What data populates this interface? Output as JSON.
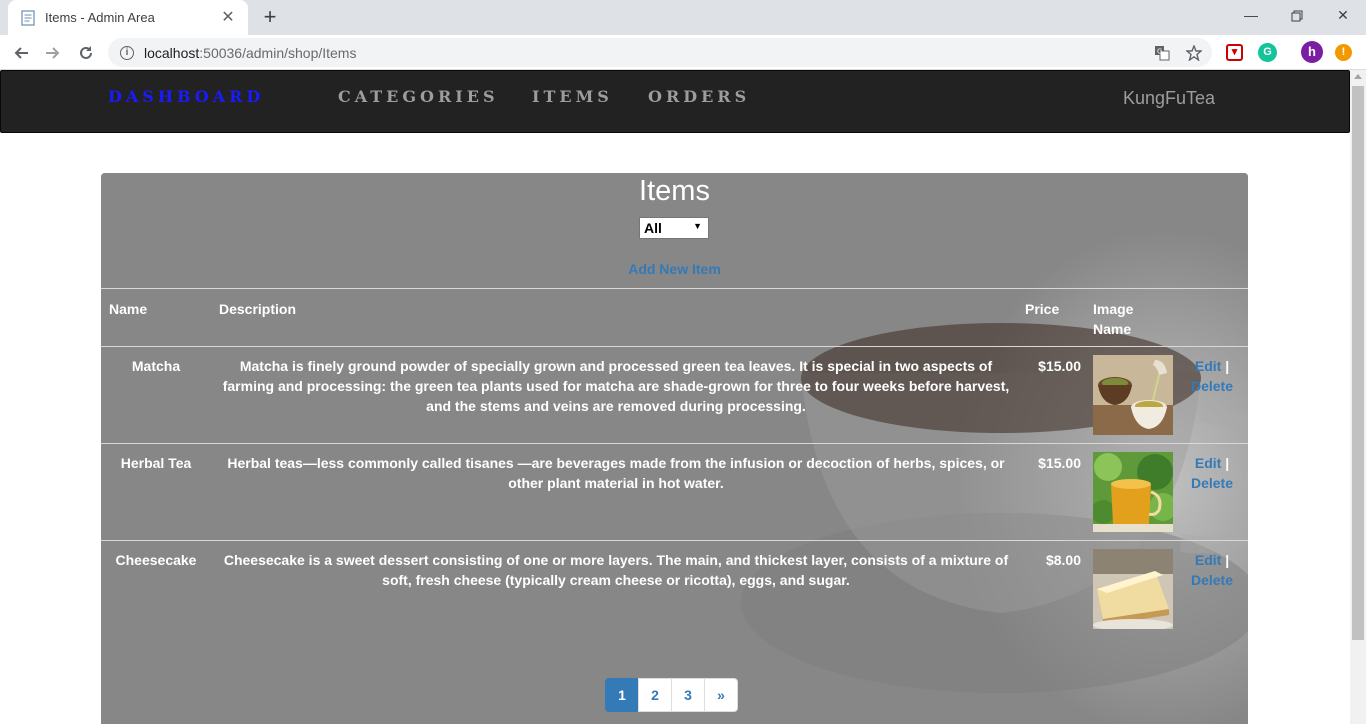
{
  "browser": {
    "tab_title": "Items - Admin Area",
    "url_host": "localhost",
    "url_path": ":50036/admin/shop/Items",
    "profile_initial": "h",
    "alert_mark": "!"
  },
  "nav": {
    "brand": "Dashboard",
    "links": [
      "Categories",
      "Items",
      "Orders"
    ],
    "right": "KungFuTea"
  },
  "panel": {
    "title": "Items",
    "filter_selected": "All",
    "add_link": "Add New Item"
  },
  "table": {
    "headers": {
      "name": "Name",
      "description": "Description",
      "price": "Price",
      "image": "Image Name"
    },
    "rows": [
      {
        "name": "Matcha",
        "description": "Matcha is finely ground powder of specially grown and processed green tea leaves. It is special in two aspects of farming and processing: the green tea plants used for matcha are shade-grown for three to four weeks before harvest, and the stems and veins are removed during processing.",
        "price": "$15.00",
        "edit": "Edit",
        "sep": "|",
        "delete": "Delete"
      },
      {
        "name": "Herbal Tea",
        "description": "Herbal teas—less commonly called tisanes —are beverages made from the infusion or decoction of herbs, spices, or other plant material in hot water.",
        "price": "$15.00",
        "edit": "Edit",
        "sep": "|",
        "delete": "Delete"
      },
      {
        "name": "Cheesecake",
        "description": "Cheesecake is a sweet dessert consisting of one or more layers. The main, and thickest layer, consists of a mixture of soft, fresh cheese (typically cream cheese or ricotta), eggs, and sugar.",
        "price": "$8.00",
        "edit": "Edit",
        "sep": "|",
        "delete": "Delete"
      }
    ]
  },
  "pagination": {
    "pages": [
      "1",
      "2",
      "3"
    ],
    "next": "»",
    "active": "1"
  },
  "colors": {
    "link": "#337ab7",
    "navbar_bg": "#222222",
    "brand": "#1a1aff",
    "panel_bg": "#878787"
  }
}
